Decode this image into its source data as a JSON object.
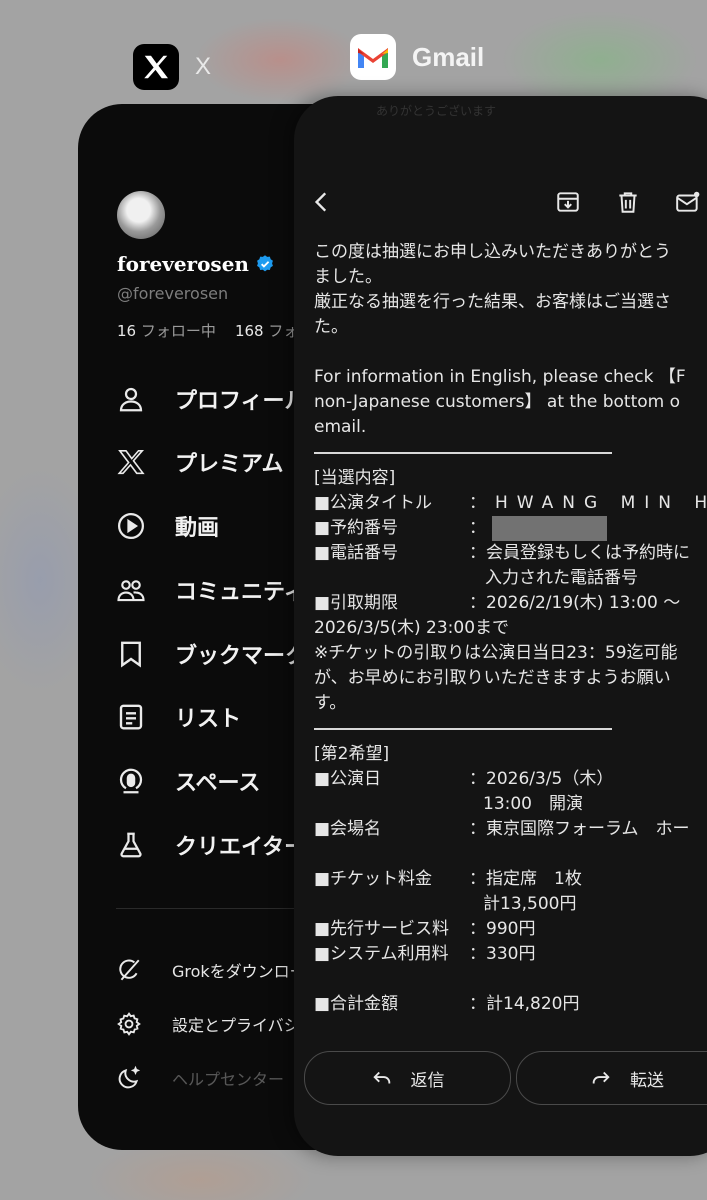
{
  "switcher": {
    "x_app_name": "X",
    "gmail_app_name": "Gmail"
  },
  "x": {
    "display_name": "foreverosen",
    "handle": "@foreverosen",
    "following_count": "16",
    "following_label": "フォロー中",
    "followers_count": "168",
    "followers_label": "フォ",
    "menu": [
      {
        "label": "プロフィール",
        "icon": "person-icon"
      },
      {
        "label": "プレミアム",
        "icon": "x-logo-icon"
      },
      {
        "label": "動画",
        "icon": "play-icon"
      },
      {
        "label": "コミュニティ",
        "icon": "community-icon"
      },
      {
        "label": "ブックマーク",
        "icon": "bookmark-icon"
      },
      {
        "label": "リスト",
        "icon": "list-icon"
      },
      {
        "label": "スペース",
        "icon": "spaces-icon"
      },
      {
        "label": "クリエイター",
        "icon": "creator-flask-icon"
      }
    ],
    "bottom": [
      {
        "label": "Grokをダウンロード",
        "icon": "grok-icon"
      },
      {
        "label": "設定とプライバシー",
        "icon": "settings-gear-icon"
      },
      {
        "label": "ヘルプセンター",
        "icon": "moon-icon"
      }
    ]
  },
  "gmail": {
    "status_ghost": "ありがとうございます",
    "lines": {
      "l1": "この度は抽選にお申し込みいただきありがとう",
      "l2": "ました。",
      "l3": "厳正なる抽選を行った結果、お客様はご当選さ",
      "l4": "た。",
      "l5": "For information in English, please check 【F",
      "l6": "non-Japanese customers】 at the bottom o",
      "l7": "email.",
      "section1": "[当選内容]",
      "title_k": "■公演タイトル",
      "title_v": "：HWANG MIN HY",
      "resv_k": "■予約番号",
      "resv_v": "：",
      "tel_k": "■電話番号",
      "tel_v1": "：会員登録もしくは予約時に",
      "tel_v2": "入力された電話番号",
      "period_k": "■引取期限",
      "period_v": "：2026/2/19(木) 13:00 ～",
      "period_v2": "2026/3/5(木) 23:00まで",
      "note1": "※チケットの引取りは公演日当日23：59迄可能",
      "note2": "が、お早めにお引取りいただきますようお願い",
      "note3": "す。",
      "section2": "[第2希望]",
      "date_k": "■公演日",
      "date_v1": "：2026/3/5（木）",
      "date_v2": "13:00　開演",
      "venue_k": "■会場名",
      "venue_v": "：東京国際フォーラム　ホー",
      "fee_k": "■チケット料金",
      "fee_v1": "：指定席　1枚",
      "fee_v2": "計13,500円",
      "svc_k": "■先行サービス料",
      "svc_v": "：990円",
      "sys_k": "■システム利用料",
      "sys_v": "：330円",
      "total_k": "■合計金額",
      "total_v": "：計14,820円"
    },
    "reply_label": "返信",
    "forward_label": "転送"
  }
}
